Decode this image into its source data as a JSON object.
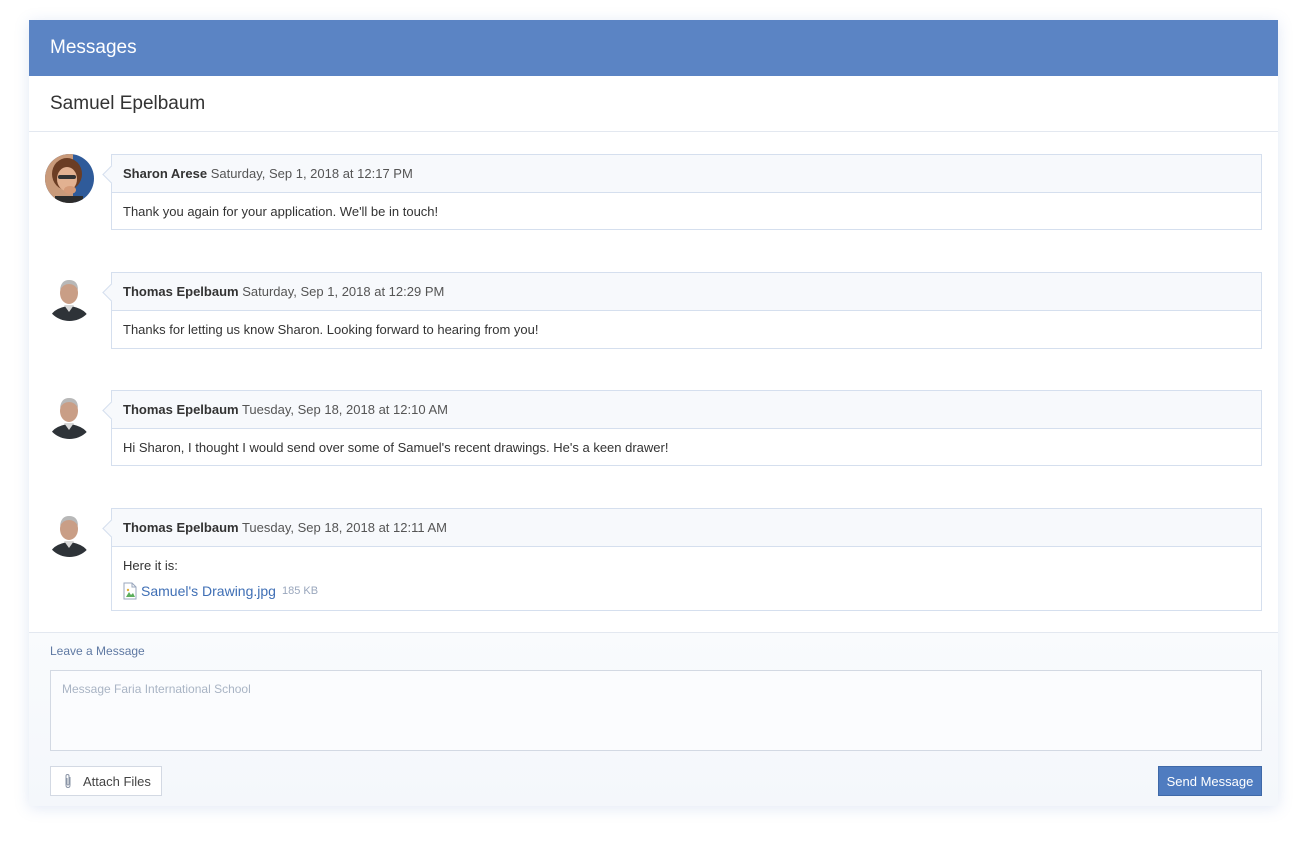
{
  "header": {
    "title": "Messages"
  },
  "thread": {
    "title": "Samuel Epelbaum"
  },
  "messages": [
    {
      "author": "Sharon Arese",
      "timestamp": "Saturday, Sep 1, 2018 at 12:17 PM",
      "body": "Thank you again for your application. We'll be in touch!"
    },
    {
      "author": "Thomas Epelbaum",
      "timestamp": "Saturday, Sep 1, 2018 at 12:29 PM",
      "body": "Thanks for letting us know Sharon. Looking forward to hearing from you!"
    },
    {
      "author": "Thomas Epelbaum",
      "timestamp": "Tuesday, Sep 18, 2018 at 12:10 AM",
      "body": "Hi Sharon, I thought I would send over some of Samuel's recent drawings. He's a keen drawer!"
    },
    {
      "author": "Thomas Epelbaum",
      "timestamp": "Tuesday, Sep 18, 2018 at 12:11 AM",
      "body": "Here it is:",
      "attachment": {
        "name": "Samuel's Drawing.jpg",
        "size": "185 KB",
        "icon": "image-file-icon"
      }
    }
  ],
  "compose": {
    "label": "Leave a Message",
    "placeholder": "Message Faria International School",
    "attach_label": "Attach Files",
    "send_label": "Send Message"
  },
  "colors": {
    "header_bg": "#5b84c4",
    "send_button": "#4f7cc0",
    "link": "#3f6fb5"
  }
}
